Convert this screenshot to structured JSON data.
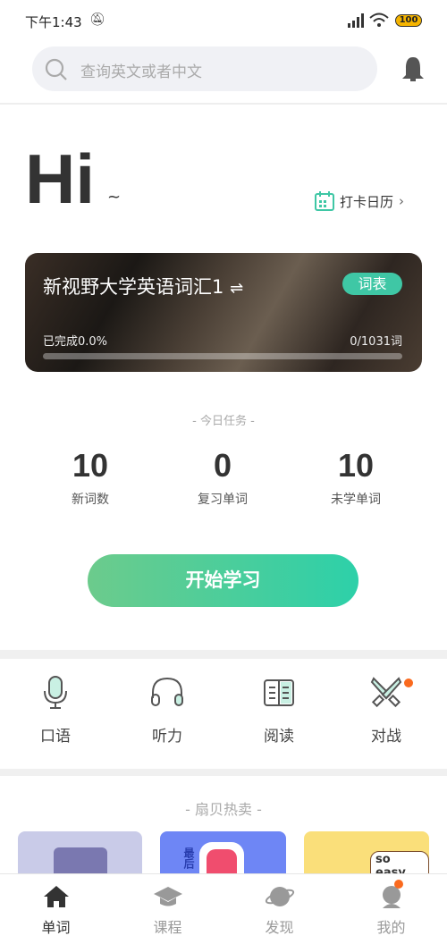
{
  "status_bar": {
    "time": "下午1:43",
    "battery": "100"
  },
  "search": {
    "placeholder": "查询英文或者中文"
  },
  "greeting": {
    "hi": "Hi",
    "tilde": "~",
    "calendar_label": "打卡日历"
  },
  "book_card": {
    "title": "新视野大学英语词汇1",
    "badge": "词表",
    "progress_text": "已完成0.0%",
    "progress_percent": 0.0,
    "count": "0/1031词"
  },
  "today": {
    "heading": "- 今日任务 -",
    "stats": [
      {
        "value": "10",
        "label": "新词数"
      },
      {
        "value": "0",
        "label": "复习单词"
      },
      {
        "value": "10",
        "label": "未学单词"
      }
    ]
  },
  "start_button": "开始学习",
  "features": [
    {
      "label": "口语",
      "icon": "microphone-icon"
    },
    {
      "label": "听力",
      "icon": "headphones-icon"
    },
    {
      "label": "阅读",
      "icon": "book-icon"
    },
    {
      "label": "对战",
      "icon": "swords-icon",
      "badge_dot": true
    }
  ],
  "hot": {
    "heading": "- 扇贝热卖 -",
    "products": [
      {
        "color": "#c9cbe8"
      },
      {
        "color": "#6e86f5",
        "text": "最后"
      },
      {
        "color": "#fadf7a",
        "text": "so easy"
      }
    ]
  },
  "bottom_nav": [
    {
      "label": "单词",
      "active": true
    },
    {
      "label": "课程"
    },
    {
      "label": "发现"
    },
    {
      "label": "我的",
      "badge_dot": true
    }
  ],
  "colors": {
    "accent": "#3fc7a5",
    "notification": "#fa6a1e"
  }
}
